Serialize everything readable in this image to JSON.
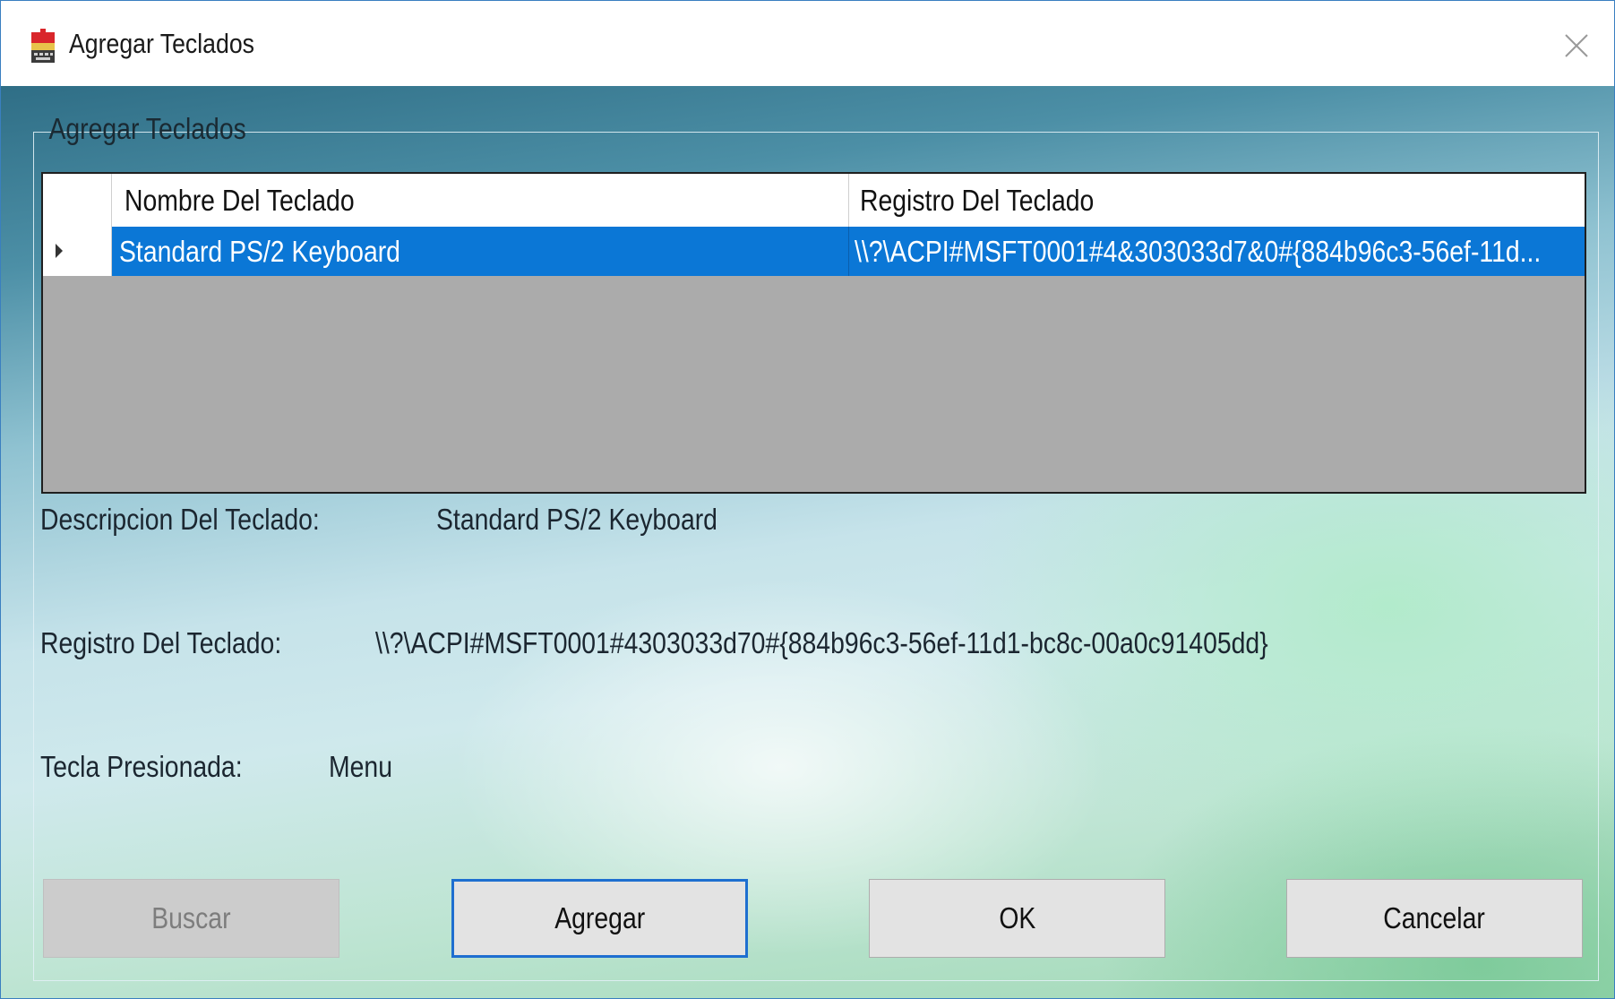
{
  "window": {
    "title": "Agregar Teclados",
    "app_icon": "keyboard-app-icon",
    "close_icon": "close-icon"
  },
  "group": {
    "label": "Agregar Teclados"
  },
  "grid": {
    "columns": [
      "Nombre Del Teclado",
      "Registro Del Teclado"
    ],
    "rows": [
      {
        "nombre": "Standard PS/2 Keyboard",
        "registro": "\\\\?\\ACPI#MSFT0001#4&303033d7&0#{884b96c3-56ef-11d..."
      }
    ],
    "selected_row": 0,
    "selection_color": "#0b77d6"
  },
  "details": {
    "descripcion_label": "Descripcion Del Teclado:",
    "descripcion_value": "Standard PS/2 Keyboard",
    "registro_label": "Registro Del Teclado:",
    "registro_value": "\\\\?\\ACPI#MSFT0001#4303033d70#{884b96c3-56ef-11d1-bc8c-00a0c91405dd}",
    "tecla_label": "Tecla Presionada:",
    "tecla_value": "Menu"
  },
  "buttons": {
    "buscar": "Buscar",
    "agregar": "Agregar",
    "ok": "OK",
    "cancelar": "Cancelar"
  }
}
